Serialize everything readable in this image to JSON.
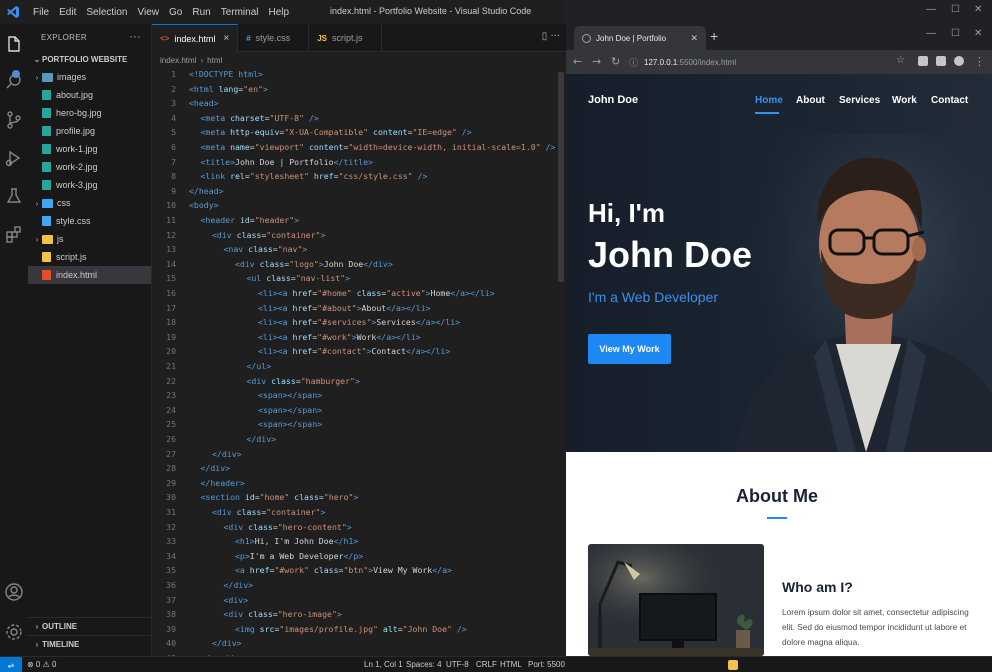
{
  "vscode": {
    "menu": [
      "File",
      "Edit",
      "Selection",
      "View",
      "Go",
      "Run",
      "Terminal",
      "Help"
    ],
    "window_title": "index.html - Portfolio Website - Visual Studio Code",
    "explorer": {
      "title": "EXPLORER",
      "more": "···",
      "project": "PORTFOLIO WEBSITE",
      "tree": [
        {
          "label": "images",
          "kind": "folder",
          "depth": 0
        },
        {
          "label": "about.jpg",
          "kind": "image",
          "depth": 1
        },
        {
          "label": "hero-bg.jpg",
          "kind": "image",
          "depth": 1
        },
        {
          "label": "profile.jpg",
          "kind": "image",
          "depth": 1
        },
        {
          "label": "work-1.jpg",
          "kind": "image",
          "depth": 1
        },
        {
          "label": "work-2.jpg",
          "kind": "image",
          "depth": 1
        },
        {
          "label": "work-3.jpg",
          "kind": "image",
          "depth": 1
        },
        {
          "label": "css",
          "kind": "folder",
          "depth": 0
        },
        {
          "label": "style.css",
          "kind": "css",
          "depth": 1
        },
        {
          "label": "js",
          "kind": "folder",
          "depth": 0
        },
        {
          "label": "script.js",
          "kind": "js",
          "depth": 1
        },
        {
          "label": "index.html",
          "kind": "html",
          "depth": 0,
          "selected": true
        }
      ],
      "outline": "OUTLINE",
      "timeline": "TIMELINE"
    },
    "tabs": [
      {
        "label": "index.html",
        "icon": "<>",
        "color": "#e44d26",
        "active": true
      },
      {
        "label": "style.css",
        "icon": "#",
        "color": "#42a5f5",
        "active": false
      },
      {
        "label": "script.js",
        "icon": "JS",
        "color": "#f0c14b",
        "active": false
      }
    ],
    "breadcrumb": [
      "index.html",
      "html"
    ],
    "code": [
      {
        "n": "1",
        "indent": 0,
        "parts": [
          [
            "t-tag",
            "<!DOCTYPE html>"
          ]
        ]
      },
      {
        "n": "2",
        "indent": 0,
        "parts": [
          [
            "t-tag",
            "<html "
          ],
          [
            "t-attr",
            "lang"
          ],
          [
            "t-txt",
            "="
          ],
          [
            "t-str",
            "\"en\""
          ],
          [
            "t-tag",
            ">"
          ]
        ]
      },
      {
        "n": "3",
        "indent": 0,
        "parts": [
          [
            "t-tag",
            "<head>"
          ]
        ]
      },
      {
        "n": "4",
        "indent": 1,
        "parts": [
          [
            "t-tag",
            "<meta "
          ],
          [
            "t-attr",
            "charset"
          ],
          [
            "t-txt",
            "="
          ],
          [
            "t-str",
            "\"UTF-8\""
          ],
          [
            "t-tag",
            " />"
          ]
        ]
      },
      {
        "n": "5",
        "indent": 1,
        "parts": [
          [
            "t-tag",
            "<meta "
          ],
          [
            "t-attr",
            "http-equiv"
          ],
          [
            "t-txt",
            "="
          ],
          [
            "t-str",
            "\"X-UA-Compatible\""
          ],
          [
            "t-attr",
            " content"
          ],
          [
            "t-txt",
            "="
          ],
          [
            "t-str",
            "\"IE=edge\""
          ],
          [
            "t-tag",
            " />"
          ]
        ]
      },
      {
        "n": "6",
        "indent": 1,
        "parts": [
          [
            "t-tag",
            "<meta "
          ],
          [
            "t-attr",
            "name"
          ],
          [
            "t-txt",
            "="
          ],
          [
            "t-str",
            "\"viewport\""
          ],
          [
            "t-attr",
            " content"
          ],
          [
            "t-txt",
            "="
          ],
          [
            "t-str",
            "\"width=device-width, initial-scale=1.0\""
          ],
          [
            "t-tag",
            " />"
          ]
        ]
      },
      {
        "n": "7",
        "indent": 1,
        "parts": [
          [
            "t-tag",
            "<title>"
          ],
          [
            "t-txt",
            "John Doe | Portfolio"
          ],
          [
            "t-tag",
            "</title>"
          ]
        ]
      },
      {
        "n": "8",
        "indent": 1,
        "parts": [
          [
            "t-tag",
            "<link "
          ],
          [
            "t-attr",
            "rel"
          ],
          [
            "t-txt",
            "="
          ],
          [
            "t-str",
            "\"stylesheet\""
          ],
          [
            "t-attr",
            " href"
          ],
          [
            "t-txt",
            "="
          ],
          [
            "t-str",
            "\"css/style.css\""
          ],
          [
            "t-tag",
            " />"
          ]
        ]
      },
      {
        "n": "9",
        "indent": 0,
        "parts": [
          [
            "t-tag",
            "</head>"
          ]
        ]
      },
      {
        "n": "10",
        "indent": 0,
        "parts": [
          [
            "t-tag",
            "<body>"
          ]
        ]
      },
      {
        "n": "11",
        "indent": 1,
        "parts": [
          [
            "t-tag",
            "<header "
          ],
          [
            "t-attr",
            "id"
          ],
          [
            "t-txt",
            "="
          ],
          [
            "t-str",
            "\"header\""
          ],
          [
            "t-tag",
            ">"
          ]
        ]
      },
      {
        "n": "12",
        "indent": 2,
        "parts": [
          [
            "t-tag",
            "<div "
          ],
          [
            "t-attr",
            "class"
          ],
          [
            "t-txt",
            "="
          ],
          [
            "t-str",
            "\"container\""
          ],
          [
            "t-tag",
            ">"
          ]
        ]
      },
      {
        "n": "13",
        "indent": 3,
        "parts": [
          [
            "t-tag",
            "<nav "
          ],
          [
            "t-attr",
            "class"
          ],
          [
            "t-txt",
            "="
          ],
          [
            "t-str",
            "\"nav\""
          ],
          [
            "t-tag",
            ">"
          ]
        ]
      },
      {
        "n": "14",
        "indent": 4,
        "parts": [
          [
            "t-tag",
            "<div "
          ],
          [
            "t-attr",
            "class"
          ],
          [
            "t-txt",
            "="
          ],
          [
            "t-str",
            "\"logo\""
          ],
          [
            "t-tag",
            ">"
          ],
          [
            "t-txt",
            "John Doe"
          ],
          [
            "t-tag",
            "</div>"
          ]
        ]
      },
      {
        "n": "15",
        "indent": 5,
        "parts": [
          [
            "t-tag",
            "<ul "
          ],
          [
            "t-attr",
            "class"
          ],
          [
            "t-txt",
            "="
          ],
          [
            "t-str",
            "\"nav-list\""
          ],
          [
            "t-tag",
            ">"
          ]
        ]
      },
      {
        "n": "16",
        "indent": 6,
        "parts": [
          [
            "t-tag",
            "<li><a "
          ],
          [
            "t-attr",
            "href"
          ],
          [
            "t-txt",
            "="
          ],
          [
            "t-str",
            "\"#home\""
          ],
          [
            "t-attr",
            " class"
          ],
          [
            "t-txt",
            "="
          ],
          [
            "t-str",
            "\"active\""
          ],
          [
            "t-tag",
            ">"
          ],
          [
            "t-txt",
            "Home"
          ],
          [
            "t-tag",
            "</a></li>"
          ]
        ]
      },
      {
        "n": "17",
        "indent": 6,
        "parts": [
          [
            "t-tag",
            "<li><a "
          ],
          [
            "t-attr",
            "href"
          ],
          [
            "t-txt",
            "="
          ],
          [
            "t-str",
            "\"#about\""
          ],
          [
            "t-tag",
            ">"
          ],
          [
            "t-txt",
            "About"
          ],
          [
            "t-tag",
            "</a></li>"
          ]
        ]
      },
      {
        "n": "18",
        "indent": 6,
        "parts": [
          [
            "t-tag",
            "<li><a "
          ],
          [
            "t-attr",
            "href"
          ],
          [
            "t-txt",
            "="
          ],
          [
            "t-str",
            "\"#services\""
          ],
          [
            "t-tag",
            ">"
          ],
          [
            "t-txt",
            "Services"
          ],
          [
            "t-tag",
            "</a></li>"
          ]
        ]
      },
      {
        "n": "19",
        "indent": 6,
        "parts": [
          [
            "t-tag",
            "<li><a "
          ],
          [
            "t-attr",
            "href"
          ],
          [
            "t-txt",
            "="
          ],
          [
            "t-str",
            "\"#work\""
          ],
          [
            "t-tag",
            ">"
          ],
          [
            "t-txt",
            "Work"
          ],
          [
            "t-tag",
            "</a></li>"
          ]
        ]
      },
      {
        "n": "20",
        "indent": 6,
        "parts": [
          [
            "t-tag",
            "<li><a "
          ],
          [
            "t-attr",
            "href"
          ],
          [
            "t-txt",
            "="
          ],
          [
            "t-str",
            "\"#contact\""
          ],
          [
            "t-tag",
            ">"
          ],
          [
            "t-txt",
            "Contact"
          ],
          [
            "t-tag",
            "</a></li>"
          ]
        ]
      },
      {
        "n": "21",
        "indent": 5,
        "parts": [
          [
            "t-tag",
            "</ul>"
          ]
        ]
      },
      {
        "n": "22",
        "indent": 5,
        "parts": [
          [
            "t-tag",
            "<div "
          ],
          [
            "t-attr",
            "class"
          ],
          [
            "t-txt",
            "="
          ],
          [
            "t-str",
            "\"hamburger\""
          ],
          [
            "t-tag",
            ">"
          ]
        ]
      },
      {
        "n": "23",
        "indent": 6,
        "parts": [
          [
            "t-tag",
            "<span></span>"
          ]
        ]
      },
      {
        "n": "24",
        "indent": 6,
        "parts": [
          [
            "t-tag",
            "<span></span>"
          ]
        ]
      },
      {
        "n": "25",
        "indent": 6,
        "parts": [
          [
            "t-tag",
            "<span></span>"
          ]
        ]
      },
      {
        "n": "26",
        "indent": 5,
        "parts": [
          [
            "t-tag",
            "</div>"
          ]
        ]
      },
      {
        "n": "27",
        "indent": 2,
        "parts": [
          [
            "t-tag",
            "</div>"
          ]
        ]
      },
      {
        "n": "28",
        "indent": 1,
        "parts": [
          [
            "t-tag",
            "</div>"
          ]
        ]
      },
      {
        "n": "29",
        "indent": 1,
        "parts": [
          [
            "t-tag",
            "</header>"
          ]
        ]
      },
      {
        "n": "30",
        "indent": 1,
        "parts": [
          [
            "t-tag",
            "<section "
          ],
          [
            "t-attr",
            "id"
          ],
          [
            "t-txt",
            "="
          ],
          [
            "t-str",
            "\"home\""
          ],
          [
            "t-attr",
            " class"
          ],
          [
            "t-txt",
            "="
          ],
          [
            "t-str",
            "\"hero\""
          ],
          [
            "t-tag",
            ">"
          ]
        ]
      },
      {
        "n": "31",
        "indent": 2,
        "parts": [
          [
            "t-tag",
            "<div "
          ],
          [
            "t-attr",
            "class"
          ],
          [
            "t-txt",
            "="
          ],
          [
            "t-str",
            "\"container\""
          ],
          [
            "t-tag",
            ">"
          ]
        ]
      },
      {
        "n": "32",
        "indent": 3,
        "parts": [
          [
            "t-tag",
            "<div "
          ],
          [
            "t-attr",
            "class"
          ],
          [
            "t-txt",
            "="
          ],
          [
            "t-str",
            "\"hero-content\""
          ],
          [
            "t-tag",
            ">"
          ]
        ]
      },
      {
        "n": "33",
        "indent": 4,
        "parts": [
          [
            "t-tag",
            "<h1>"
          ],
          [
            "t-txt",
            "Hi, I'm John Doe"
          ],
          [
            "t-tag",
            "</h1>"
          ]
        ]
      },
      {
        "n": "34",
        "indent": 4,
        "parts": [
          [
            "t-tag",
            "<p>"
          ],
          [
            "t-txt",
            "I'm a Web Developer"
          ],
          [
            "t-tag",
            "</p>"
          ]
        ]
      },
      {
        "n": "35",
        "indent": 4,
        "parts": [
          [
            "t-tag",
            "<a "
          ],
          [
            "t-attr",
            "href"
          ],
          [
            "t-txt",
            "="
          ],
          [
            "t-str",
            "\"#work\""
          ],
          [
            "t-attr",
            " class"
          ],
          [
            "t-txt",
            "="
          ],
          [
            "t-str",
            "\"btn\""
          ],
          [
            "t-tag",
            ">"
          ],
          [
            "t-txt",
            "View My Work"
          ],
          [
            "t-tag",
            "</a>"
          ]
        ]
      },
      {
        "n": "36",
        "indent": 3,
        "parts": [
          [
            "t-tag",
            "</div>"
          ]
        ]
      },
      {
        "n": "37",
        "indent": 3,
        "parts": [
          [
            "t-tag",
            "<div>"
          ]
        ]
      },
      {
        "n": "38",
        "indent": 3,
        "parts": [
          [
            "t-tag",
            "<div "
          ],
          [
            "t-attr",
            "class"
          ],
          [
            "t-txt",
            "="
          ],
          [
            "t-str",
            "\"hero-image\""
          ],
          [
            "t-tag",
            ">"
          ]
        ]
      },
      {
        "n": "39",
        "indent": 4,
        "parts": [
          [
            "t-tag",
            "<img "
          ],
          [
            "t-attr",
            "src"
          ],
          [
            "t-txt",
            "="
          ],
          [
            "t-str",
            "\"images/profile.jpg\""
          ],
          [
            "t-attr",
            " alt"
          ],
          [
            "t-txt",
            "="
          ],
          [
            "t-str",
            "\"John Doe\""
          ],
          [
            "t-tag",
            " />"
          ]
        ]
      },
      {
        "n": "40",
        "indent": 2,
        "parts": [
          [
            "t-tag",
            "</div>"
          ]
        ]
      },
      {
        "n": "41",
        "indent": 1,
        "parts": [
          [
            "t-tag",
            "</section>"
          ]
        ]
      }
    ],
    "status": {
      "left": "⊗ 0  ⚠ 0",
      "position": "Ln 1, Col 1",
      "spaces": "Spaces: 4",
      "encoding": "UTF-8",
      "eol": "CRLF",
      "language": "HTML",
      "port": "Port: 5500"
    }
  },
  "browser": {
    "tab_title": "John Doe | Portfolio",
    "url_host": "127.0.0.1",
    "url_rest": ":5500/index.html",
    "site": {
      "logo": "John Doe",
      "nav": [
        "Home",
        "About",
        "Services",
        "Work",
        "Contact"
      ],
      "hero_greeting": "Hi, I'm",
      "hero_name": "John Doe",
      "hero_subtitle": "I'm a Web Developer",
      "hero_button": "View My Work",
      "about_title": "About Me",
      "who_title": "Who am I?",
      "about_text": "Lorem ipsum dolor sit amet, consectetur adipiscing elit. Sed do eiusmod tempor incididunt ut labore et dolore magna aliqua."
    }
  },
  "colors": {
    "accent": "#3b8eea",
    "editor_bg": "#1f1f1f",
    "hero_bg": "#1b2532"
  }
}
